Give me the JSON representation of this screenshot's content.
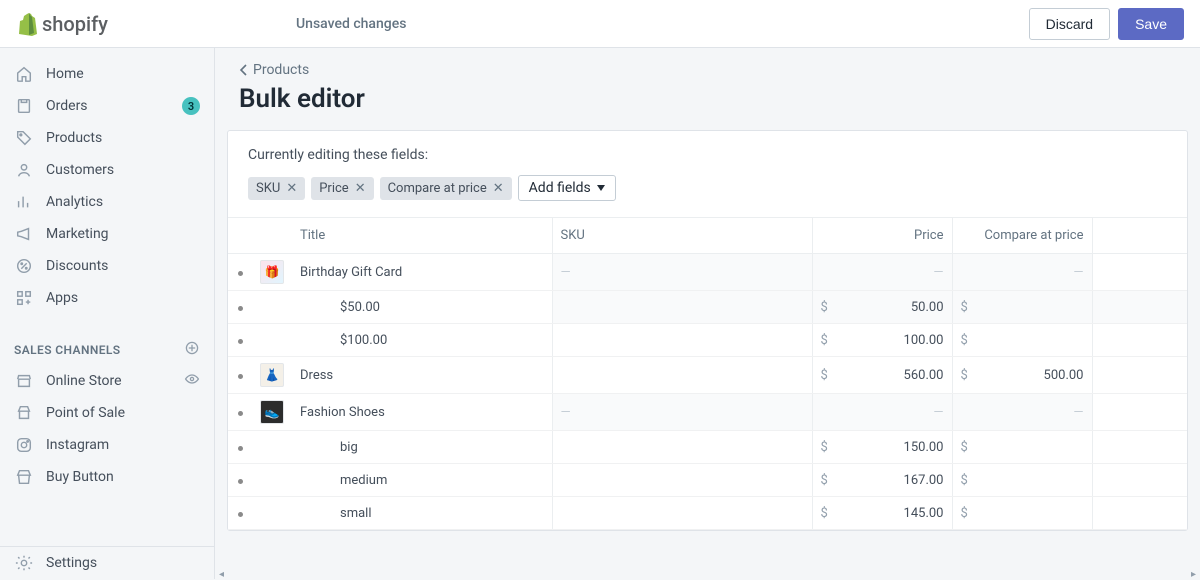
{
  "brand": "shopify",
  "topbar": {
    "status": "Unsaved changes",
    "discard": "Discard",
    "save": "Save"
  },
  "sidebar": {
    "items": [
      {
        "label": "Home"
      },
      {
        "label": "Orders",
        "badge": "3"
      },
      {
        "label": "Products"
      },
      {
        "label": "Customers"
      },
      {
        "label": "Analytics"
      },
      {
        "label": "Marketing"
      },
      {
        "label": "Discounts"
      },
      {
        "label": "Apps"
      }
    ],
    "channels_heading": "SALES CHANNELS",
    "channels": [
      {
        "label": "Online Store",
        "eye": true
      },
      {
        "label": "Point of Sale"
      },
      {
        "label": "Instagram"
      },
      {
        "label": "Buy Button"
      }
    ],
    "settings": "Settings"
  },
  "breadcrumb": {
    "parent": "Products"
  },
  "page": {
    "title": "Bulk editor"
  },
  "editor": {
    "intro": "Currently editing these fields:",
    "tags": [
      "SKU",
      "Price",
      "Compare at price"
    ],
    "add_fields": "Add fields",
    "columns": {
      "title": "Title",
      "sku": "SKU",
      "price": "Price",
      "compare": "Compare at price"
    },
    "rows": [
      {
        "type": "product",
        "title": "Birthday Gift Card",
        "thumb": "gift",
        "sku": "—",
        "price": "—",
        "compare": "—"
      },
      {
        "type": "variant",
        "title": "$50.00",
        "price": "50.00",
        "compare": "",
        "first": true
      },
      {
        "type": "variant",
        "title": "$100.00",
        "price": "100.00",
        "compare": ""
      },
      {
        "type": "product",
        "title": "Dress",
        "thumb": "dress",
        "price": "560.00",
        "compare": "500.00"
      },
      {
        "type": "product",
        "title": "Fashion Shoes",
        "thumb": "shoes",
        "sku": "—",
        "price": "—",
        "compare": "—"
      },
      {
        "type": "variant",
        "title": "big",
        "price": "150.00",
        "compare": ""
      },
      {
        "type": "variant",
        "title": "medium",
        "price": "167.00",
        "compare": ""
      },
      {
        "type": "variant",
        "title": "small",
        "price": "145.00",
        "compare": ""
      }
    ]
  }
}
